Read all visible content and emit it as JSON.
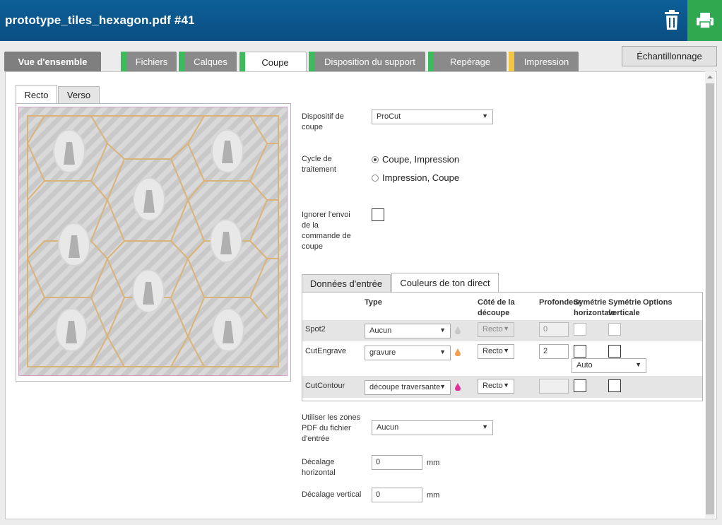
{
  "header": {
    "title": "prototype_tiles_hexagon.pdf #41"
  },
  "tabs": [
    {
      "label": "Vue d'ensemble"
    },
    {
      "label": "Fichiers",
      "status_color": "#3dba5b"
    },
    {
      "label": "Calques",
      "status_color": "#3dba5b"
    },
    {
      "label": "Coupe",
      "status_color": "#3dba5b"
    },
    {
      "label": "Disposition du support",
      "status_color": "#3dba5b"
    },
    {
      "label": "Repérage",
      "status_color": "#3dba5b"
    },
    {
      "label": "Impression",
      "status_color": "#f4c542"
    }
  ],
  "sampling_button": "Échantillonnage",
  "preview": {
    "tabs": [
      "Recto",
      "Verso"
    ]
  },
  "form": {
    "cutting_device": {
      "label": "Dispositif de coupe",
      "value": "ProCut"
    },
    "process_cycle": {
      "label": "Cycle de traitement",
      "options": [
        "Coupe, Impression",
        "Impression, Coupe"
      ],
      "selected": 0
    },
    "ignore_cut": {
      "label": "Ignorer l'envoi de la commande de coupe"
    },
    "pdf_zones": {
      "label": "Utiliser les zones PDF du fichier d'entrée",
      "value": "Aucun"
    },
    "h_offset": {
      "label": "Décalage horizontal",
      "value": "0",
      "unit": "mm"
    },
    "v_offset": {
      "label": "Décalage vertical",
      "value": "0",
      "unit": "mm"
    }
  },
  "subtabs": [
    "Données d'entrée",
    "Couleurs de ton direct"
  ],
  "spot_table": {
    "headers": {
      "type": "Type",
      "side": "Côté de la découpe",
      "depth": "Profondeur",
      "hsym": "Symétrie horizontale",
      "vsym": "Symétrie verticale",
      "options": "Options"
    },
    "rows": [
      {
        "name": "Spot2",
        "type": "Aucun",
        "drop_color": "#c8c8c8",
        "side": "Recto",
        "depth": "0"
      },
      {
        "name": "CutEngrave",
        "type": "gravure",
        "drop_color": "#f0a050",
        "side": "Recto",
        "depth": "2",
        "option": "Auto"
      },
      {
        "name": "CutContour",
        "type": "découpe traversante",
        "drop_color": "#e0309a",
        "side": "Recto",
        "depth": ""
      }
    ]
  }
}
